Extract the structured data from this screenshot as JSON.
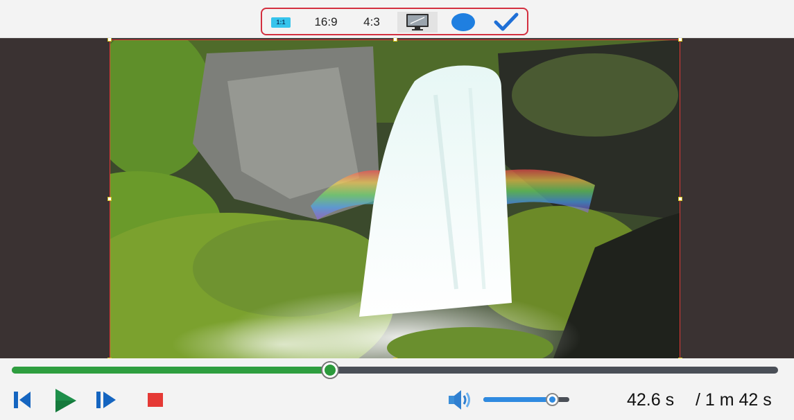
{
  "toolbar": {
    "ratio_1_1": "1:1",
    "ratio_16_9": "16:9",
    "ratio_4_3": "4:3",
    "icons": [
      "aspect-1-1-icon",
      "monitor-fit-icon",
      "ellipse-shape-icon",
      "checkmark-icon"
    ],
    "accent_color": "#d32f3f"
  },
  "player": {
    "seek_progress": 0.415,
    "volume_level": 0.8,
    "time_current": "42.6 s",
    "time_total": "/ 1 m 42 s",
    "colors": {
      "seek_fill": "#2e9e3f",
      "volume_fill": "#2f8ae0",
      "stop": "#e53935",
      "play": "#1e8f4a",
      "skip": "#1565c0"
    }
  },
  "controls": {
    "icons": [
      "step-back-icon",
      "play-icon",
      "step-forward-icon",
      "stop-icon",
      "volume-icon"
    ]
  }
}
